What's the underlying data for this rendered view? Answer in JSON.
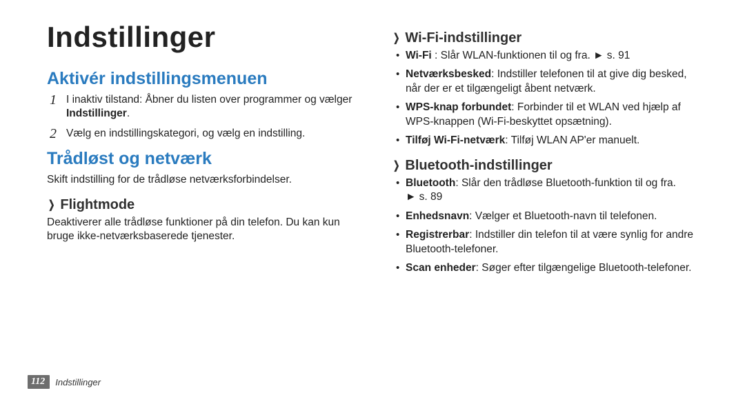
{
  "page": {
    "number": "112",
    "footer_label": "Indstillinger",
    "title": "Indstillinger"
  },
  "left": {
    "section1": {
      "heading": "Aktivér indstillingsmenuen",
      "steps": [
        {
          "num": "1",
          "pre": "I inaktiv tilstand: Åbner du listen over programmer og vælger ",
          "bold": "Indstillinger",
          "post": "."
        },
        {
          "num": "2",
          "pre": "Vælg en indstillingskategori, og vælg en indstilling.",
          "bold": "",
          "post": ""
        }
      ]
    },
    "section2": {
      "heading": "Trådløst og netværk",
      "intro": "Skift indstilling for de trådløse netværksforbindelser.",
      "sub1": {
        "heading": "Flightmode",
        "body": "Deaktiverer alle trådløse funktioner på din telefon. Du kan kun bruge ikke-netværksbaserede tjenester."
      }
    }
  },
  "right": {
    "sub_wifi": {
      "heading": "Wi-Fi-indstillinger",
      "items": [
        {
          "bold": "Wi-Fi",
          "sep": " : ",
          "text": "Slår WLAN-funktionen til og fra. ",
          "ref": "► s. 91"
        },
        {
          "bold": "Netværksbesked",
          "sep": ": ",
          "text": "Indstiller telefonen til at give dig besked, når der er et tilgængeligt åbent netværk.",
          "ref": ""
        },
        {
          "bold": "WPS-knap forbundet",
          "sep": ": ",
          "text": "Forbinder til et WLAN ved hjælp af WPS-knappen (Wi-Fi-beskyttet opsætning).",
          "ref": ""
        },
        {
          "bold": "Tilføj Wi-Fi-netværk",
          "sep": ": ",
          "text": "Tilføj WLAN AP'er manuelt.",
          "ref": ""
        }
      ]
    },
    "sub_bt": {
      "heading": "Bluetooth-indstillinger",
      "items": [
        {
          "bold": "Bluetooth",
          "sep": ": ",
          "text": "Slår den trådløse Bluetooth-funktion til og fra. ",
          "ref": "► s. 89"
        },
        {
          "bold": "Enhedsnavn",
          "sep": ": ",
          "text": "Vælger et Bluetooth-navn til telefonen.",
          "ref": ""
        },
        {
          "bold": "Registrerbar",
          "sep": ": ",
          "text": "Indstiller din telefon til at være synlig for andre Bluetooth-telefoner.",
          "ref": ""
        },
        {
          "bold": "Scan enheder",
          "sep": ": ",
          "text": "Søger efter tilgængelige Bluetooth-telefoner.",
          "ref": ""
        }
      ]
    }
  }
}
